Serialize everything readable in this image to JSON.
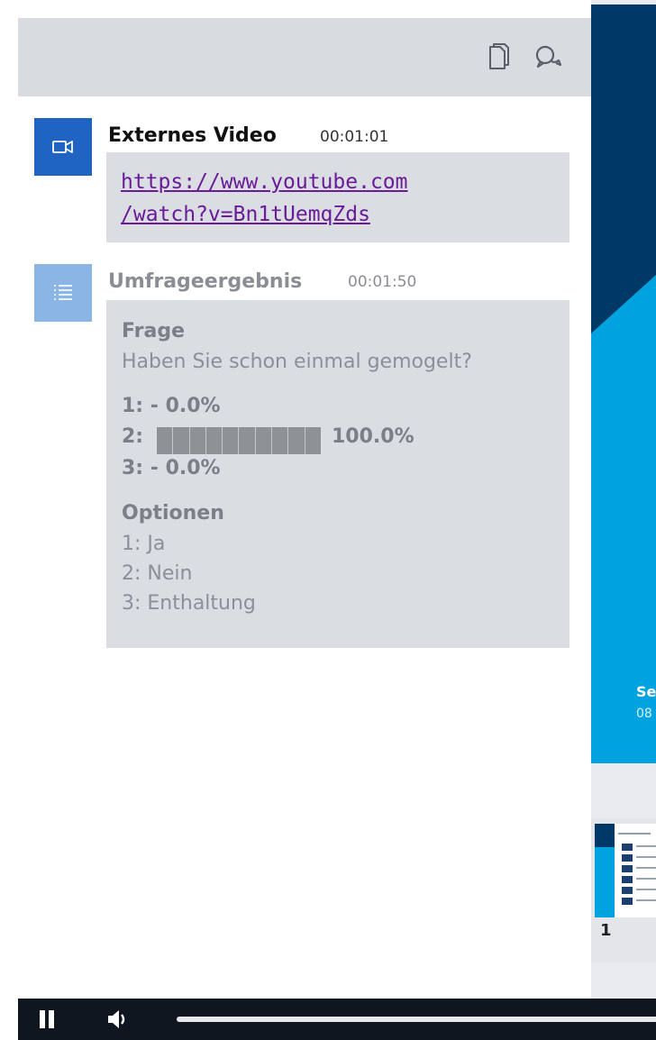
{
  "toolbar": {
    "icons": [
      "copy-icon",
      "chat-bubbles-icon"
    ]
  },
  "messages": [
    {
      "type": "external-video",
      "icon": "video-camera-icon",
      "accent_color": "#1f63c3",
      "title": "Externes Video",
      "time": "00:01:01",
      "link_line1": "https://www.youtube.com",
      "link_line2": "/watch?v=Bn1tUemqZds"
    },
    {
      "type": "poll-result",
      "icon": "list-icon",
      "accent_color": "#8bb5e4",
      "title": "Umfrageergebnis",
      "time": "00:01:50",
      "question_heading": "Frage",
      "question": "Haben Sie schon einmal gemogelt?",
      "results": [
        {
          "label": "1:",
          "value_text": "- 0.0%",
          "percent": 0
        },
        {
          "label": "2:",
          "value_text": "100.0%",
          "percent": 100
        },
        {
          "label": "3:",
          "value_text": "- 0.0%",
          "percent": 0
        }
      ],
      "options_heading": "Optionen",
      "options": [
        "1: Ja",
        "2: Nein",
        "3: Enthaltung"
      ]
    }
  ],
  "presentation": {
    "slide_text_line1": "Se",
    "slide_text_line2": "08",
    "thumbnail_number": "1",
    "colors": {
      "dark_blue": "#003866",
      "light_blue": "#00a3e0"
    }
  },
  "player": {
    "icons": [
      "pause-icon",
      "volume-icon"
    ]
  }
}
